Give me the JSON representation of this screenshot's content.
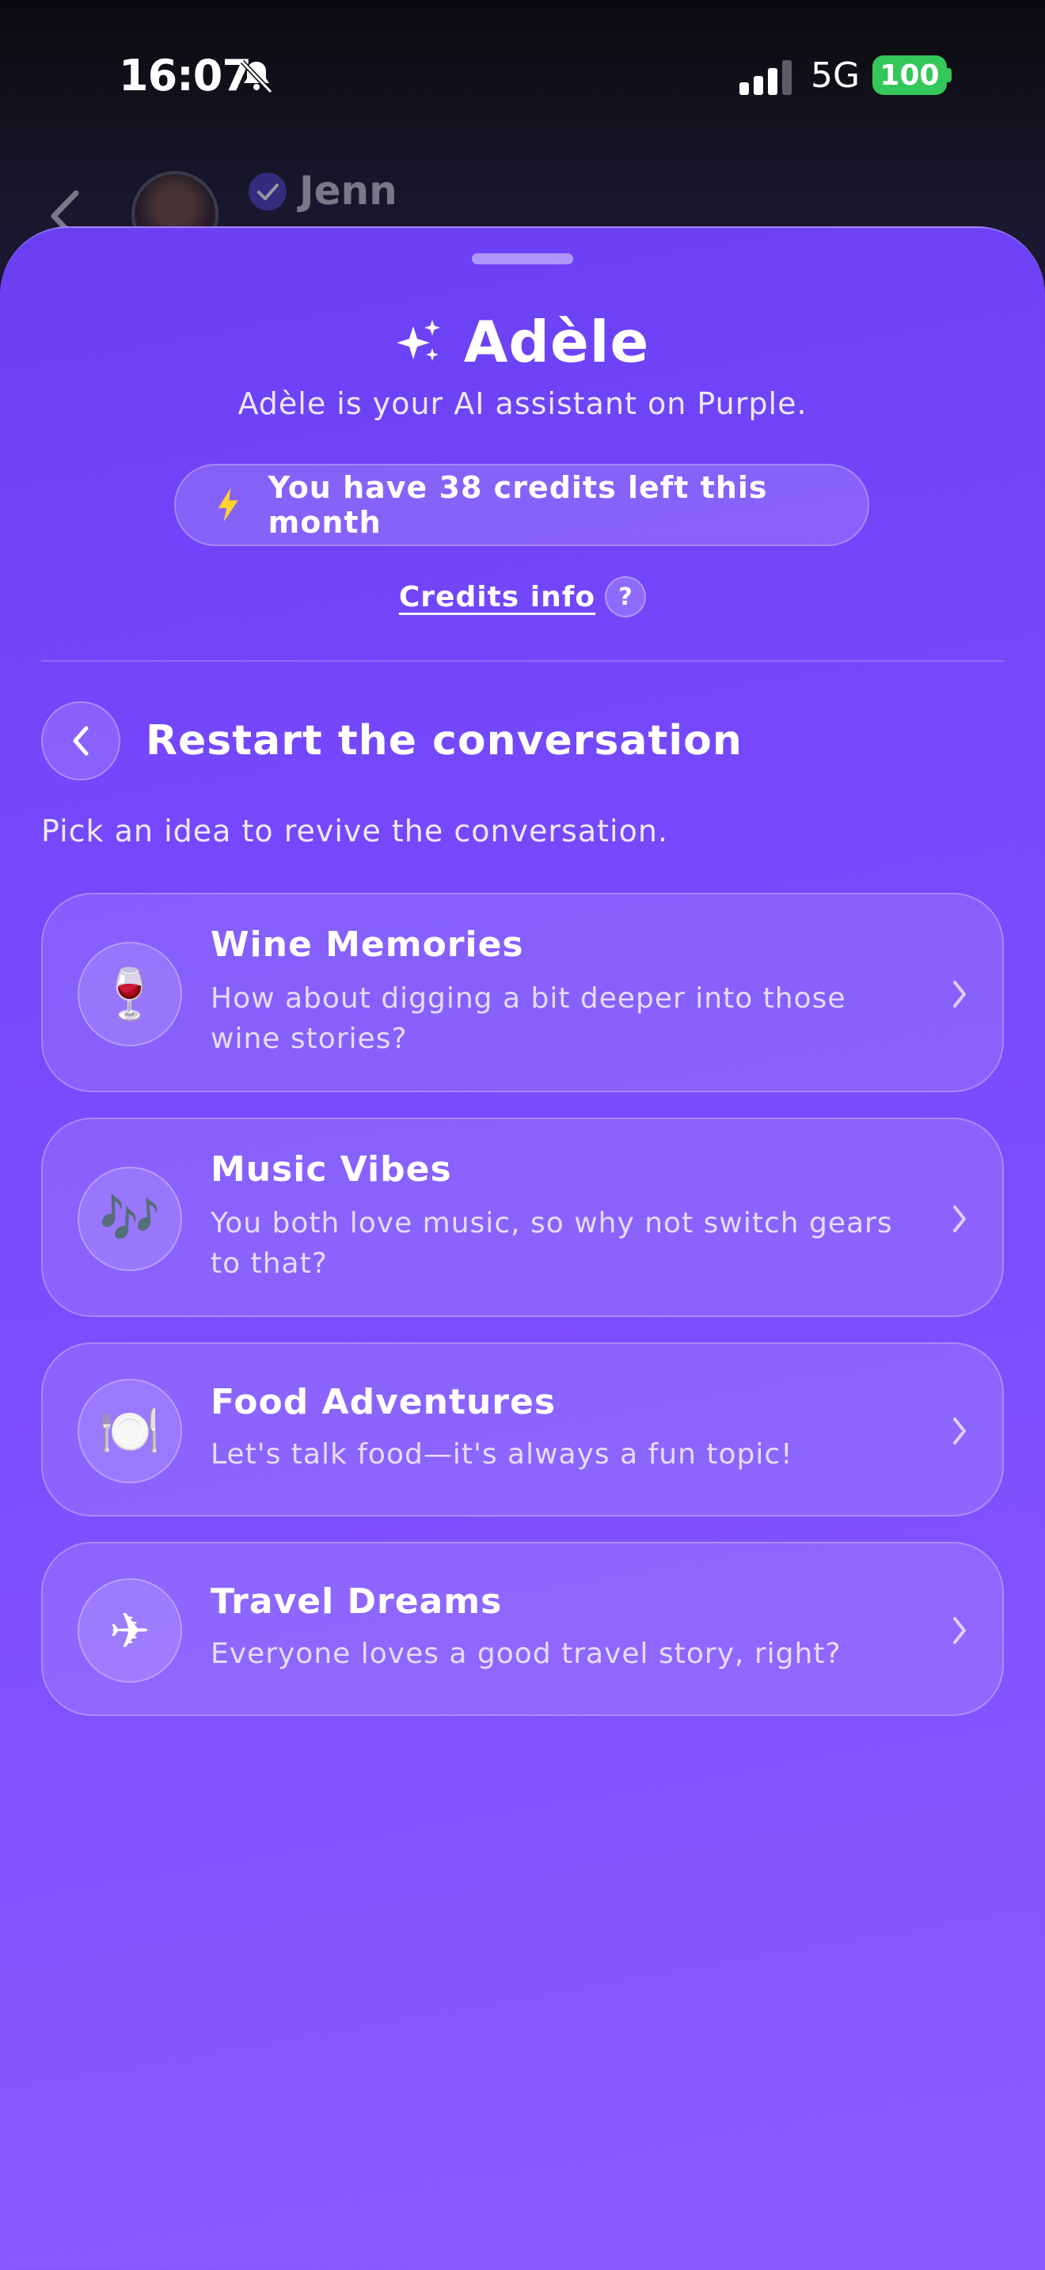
{
  "status_bar": {
    "time": "16:07",
    "network": "5G",
    "battery": "100",
    "battery_color": "#34c759"
  },
  "chat_header": {
    "contact_name": "Jenn"
  },
  "sheet": {
    "title": "Adèle",
    "subtitle": "Adèle is your AI assistant on Purple.",
    "credits_text": "You have 38 credits left this month",
    "credits_info_label": "Credits info",
    "help_symbol": "?",
    "accent_color": "#7447fb",
    "bolt_color": "#ffd22e"
  },
  "section": {
    "title": "Restart the conversation",
    "hint": "Pick an idea to revive the conversation."
  },
  "ideas": [
    {
      "icon": "🍷",
      "icon_name": "wine-glass-icon",
      "title": "Wine Memories",
      "description": "How about digging a bit deeper into those wine stories?"
    },
    {
      "icon": "🎶",
      "icon_name": "music-notes-icon",
      "title": "Music Vibes",
      "description": "You both love music, so why not switch gears to that?"
    },
    {
      "icon": "🍽️",
      "icon_name": "plate-cutlery-icon",
      "title": "Food Adventures",
      "description": "Let's talk food—it's always a fun topic!"
    },
    {
      "icon": "✈",
      "icon_name": "airplane-icon",
      "title": "Travel Dreams",
      "description": "Everyone loves a good travel story, right?"
    }
  ]
}
